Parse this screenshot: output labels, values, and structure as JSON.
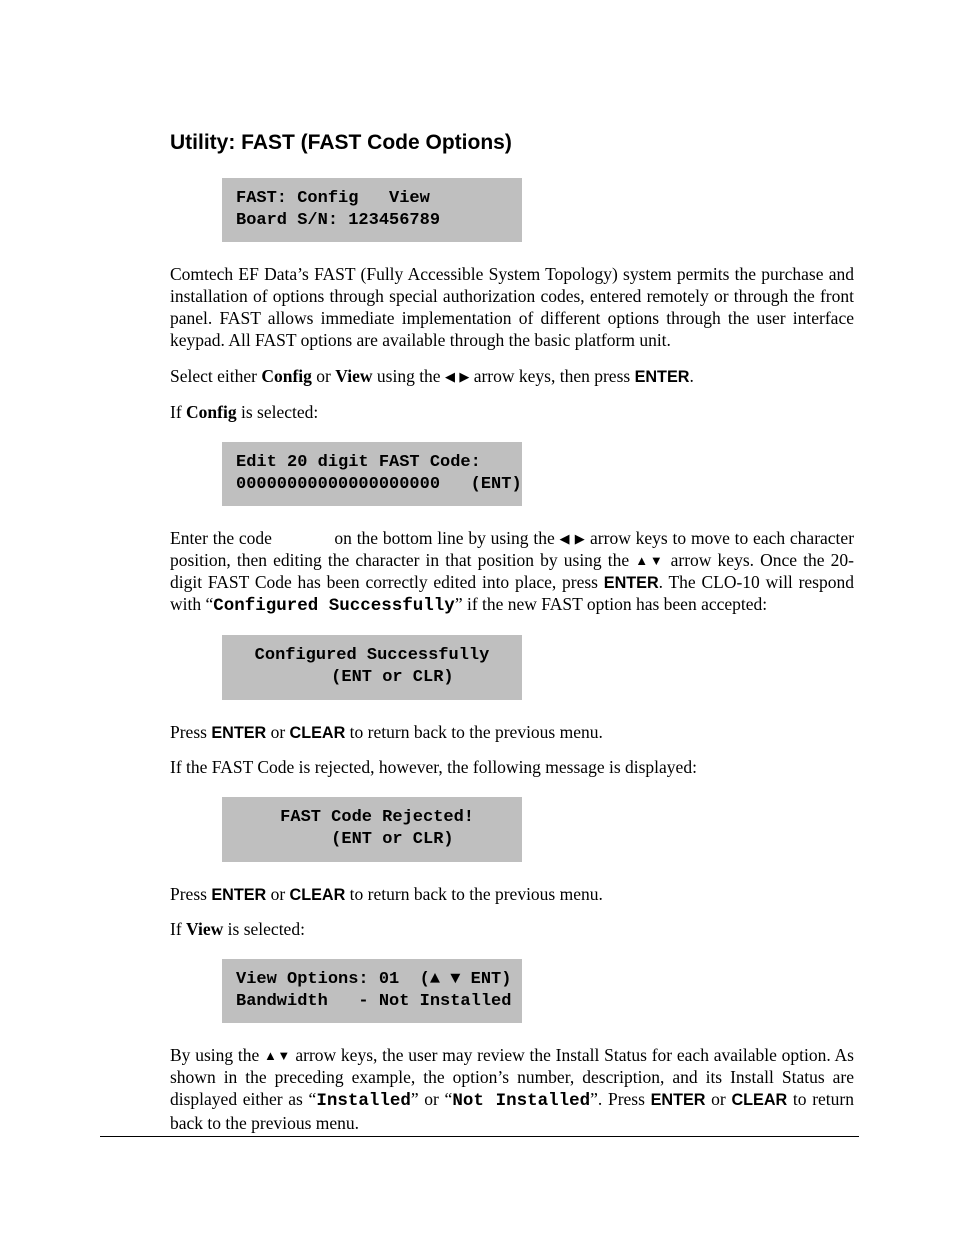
{
  "title": "Utility: FAST (FAST Code Options)",
  "lcd": {
    "main_l1": "FAST: Config   View",
    "main_l2": "Board S/N: 123456789",
    "edit_l1": "Edit 20 digit FAST Code:",
    "edit_l2": "00000000000000000000   (ENT)",
    "ok_l1": "Configured Successfully",
    "ok_l2": "    (ENT or CLR)",
    "rej_l1": " FAST Code Rejected!",
    "rej_l2": "    (ENT or CLR)",
    "view_l1": "View Options: 01  (▲ ▼ ENT)",
    "view_l2": "Bandwidth   - Not Installed"
  },
  "p": {
    "intro": "Comtech EF Data’s  FAST (Fully Accessible System Topology) system permits the purchase and installation of options through special authorization codes, entered remotely or through the front panel. FAST allows immediate implementation of different options through the user interface keypad. All FAST options are available through the basic platform unit.",
    "select_a": "Select either ",
    "config": "Config",
    "or": " or ",
    "view": "View",
    "select_b": " using the ",
    "select_c": "  arrow keys, then press ",
    "enter": "ENTER",
    "period": ".",
    "ifcfg_a": "If ",
    "ifcfg_b": " is selected:",
    "entercode_a": "Enter the code             on the bottom line by using the ",
    "entercode_b": " arrow keys to move to each character position, then editing the character in that position by using the ",
    "entercode_c": " arrow keys.  Once the 20-digit  FAST Code has been correctly edited into place, press ",
    "entercode_d": ". The CLO-10 will respond with “",
    "cfg_success": "Configured Successfully",
    "entercode_e": "” if the new FAST option has been accepted:",
    "return_a": "Press ",
    "clear": "CLEAR",
    "return_b": " to return back to the previous menu.",
    "rejected": "If the FAST Code is rejected, however, the following message is displayed:",
    "ifview_a": "If ",
    "ifview_b": " is selected:",
    "byusing_a": "By using the ",
    "byusing_b": " arrow keys, the user may review the Install Status for each available option. As shown in the preceding example, the option’s number, description, and its Install Status are displayed either as “",
    "installed": "Installed",
    "byusing_c": "” or “",
    "notinstalled": "Not Installed",
    "byusing_d": "”. Press ",
    "byusing_e": " to return back to the previous menu."
  },
  "glyph": {
    "left": "◀",
    "right": "▶",
    "up": "▲",
    "down": "▼"
  }
}
